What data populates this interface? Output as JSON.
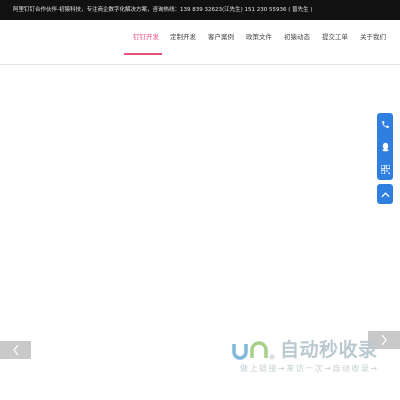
{
  "topbar": {
    "text": "阿里钉钉合作伙伴-初猿科技，专注商企数字化解决方案，咨询热线：139 839 32623(江先生)   151 230 55936 ( 曾先生 )"
  },
  "nav": {
    "items": [
      {
        "label": "钉钉开发",
        "active": true
      },
      {
        "label": "定制开发"
      },
      {
        "label": "客户案例"
      },
      {
        "label": "政策文件"
      },
      {
        "label": "初猿动态"
      },
      {
        "label": "提交工单"
      },
      {
        "label": "关于我们"
      }
    ],
    "active_color": "#e8507c"
  },
  "side_panel": {
    "color": "#2f7fe0",
    "icons": [
      "phone-icon",
      "qq-icon",
      "qrcode-icon",
      "back-to-top-icon"
    ]
  },
  "slider": {
    "prev_icon": "chevron-left-icon",
    "next_icon": "chevron-right-icon"
  },
  "watermark": {
    "title": "自动秒收录",
    "subtitle": "做上链接→来访一次→自动收录→"
  }
}
